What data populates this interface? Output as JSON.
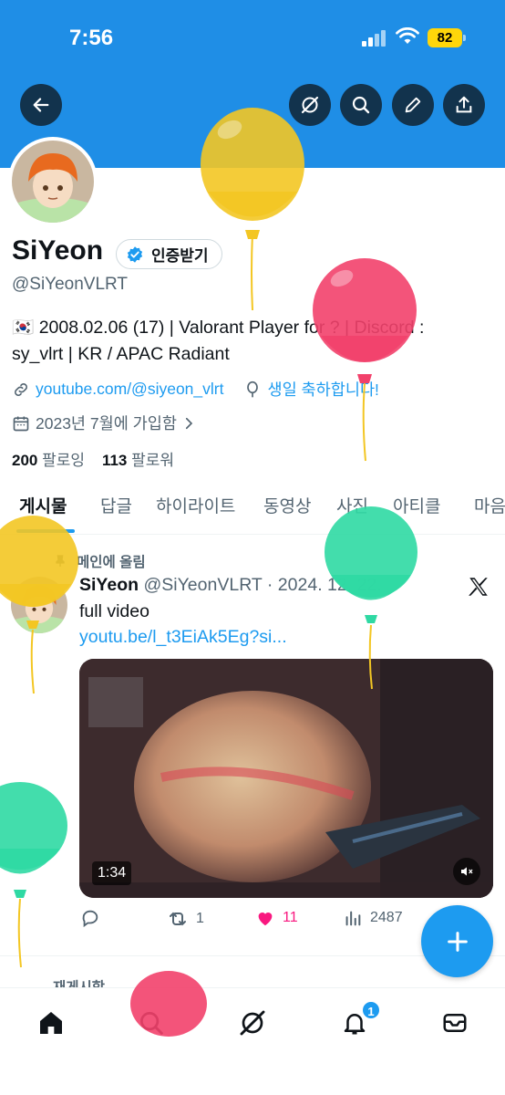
{
  "status_bar": {
    "time": "7:56",
    "battery": "82"
  },
  "header": {
    "back_icon": "arrow-left-icon",
    "actions": [
      "grok-icon",
      "search-icon",
      "edit-icon",
      "share-icon"
    ]
  },
  "profile": {
    "name": "SiYeon",
    "verify_label": "인증받기",
    "handle": "@SiYeonVLRT",
    "bio_line1": "🇰🇷 2008.02.06 (17) | Valorant Player for ? | Discord :",
    "bio_line2": "sy_vlrt | KR / APAC Radiant",
    "website": "youtube.com/@siyeon_vlrt",
    "birthday": "생일 축하합니다!",
    "joined": "2023년 7월에 가입함",
    "following_count": "200",
    "following_label": "팔로잉",
    "followers_count": "113",
    "followers_label": "팔로워"
  },
  "tabs": [
    {
      "label": "게시물",
      "active": true
    },
    {
      "label": "답글"
    },
    {
      "label": "하이라이트"
    },
    {
      "label": "동영상"
    },
    {
      "label": "사진"
    },
    {
      "label": "아티클"
    },
    {
      "label": "마음"
    }
  ],
  "pinned_post": {
    "pinned_label": "메인에 올림",
    "author": "SiYeon",
    "handle_date": "@SiYeonVLRT · 2024. 12. 22.",
    "text": "full video",
    "link": "youtu.be/l_t3EiAk5Eg?si...",
    "video_duration": "1:34",
    "reply_count": "",
    "retweet_count": "1",
    "like_count": "11",
    "view_count": "2487"
  },
  "next_post": {
    "reposted_label": "재게시함"
  },
  "notifications_badge": "1",
  "colors": {
    "banner": "#1f8ee6",
    "accent": "#1d9bf0",
    "like": "#f91880",
    "balloon_yellow": "#f3c623",
    "balloon_red": "#f2416b",
    "balloon_green": "#2fd9a3"
  }
}
